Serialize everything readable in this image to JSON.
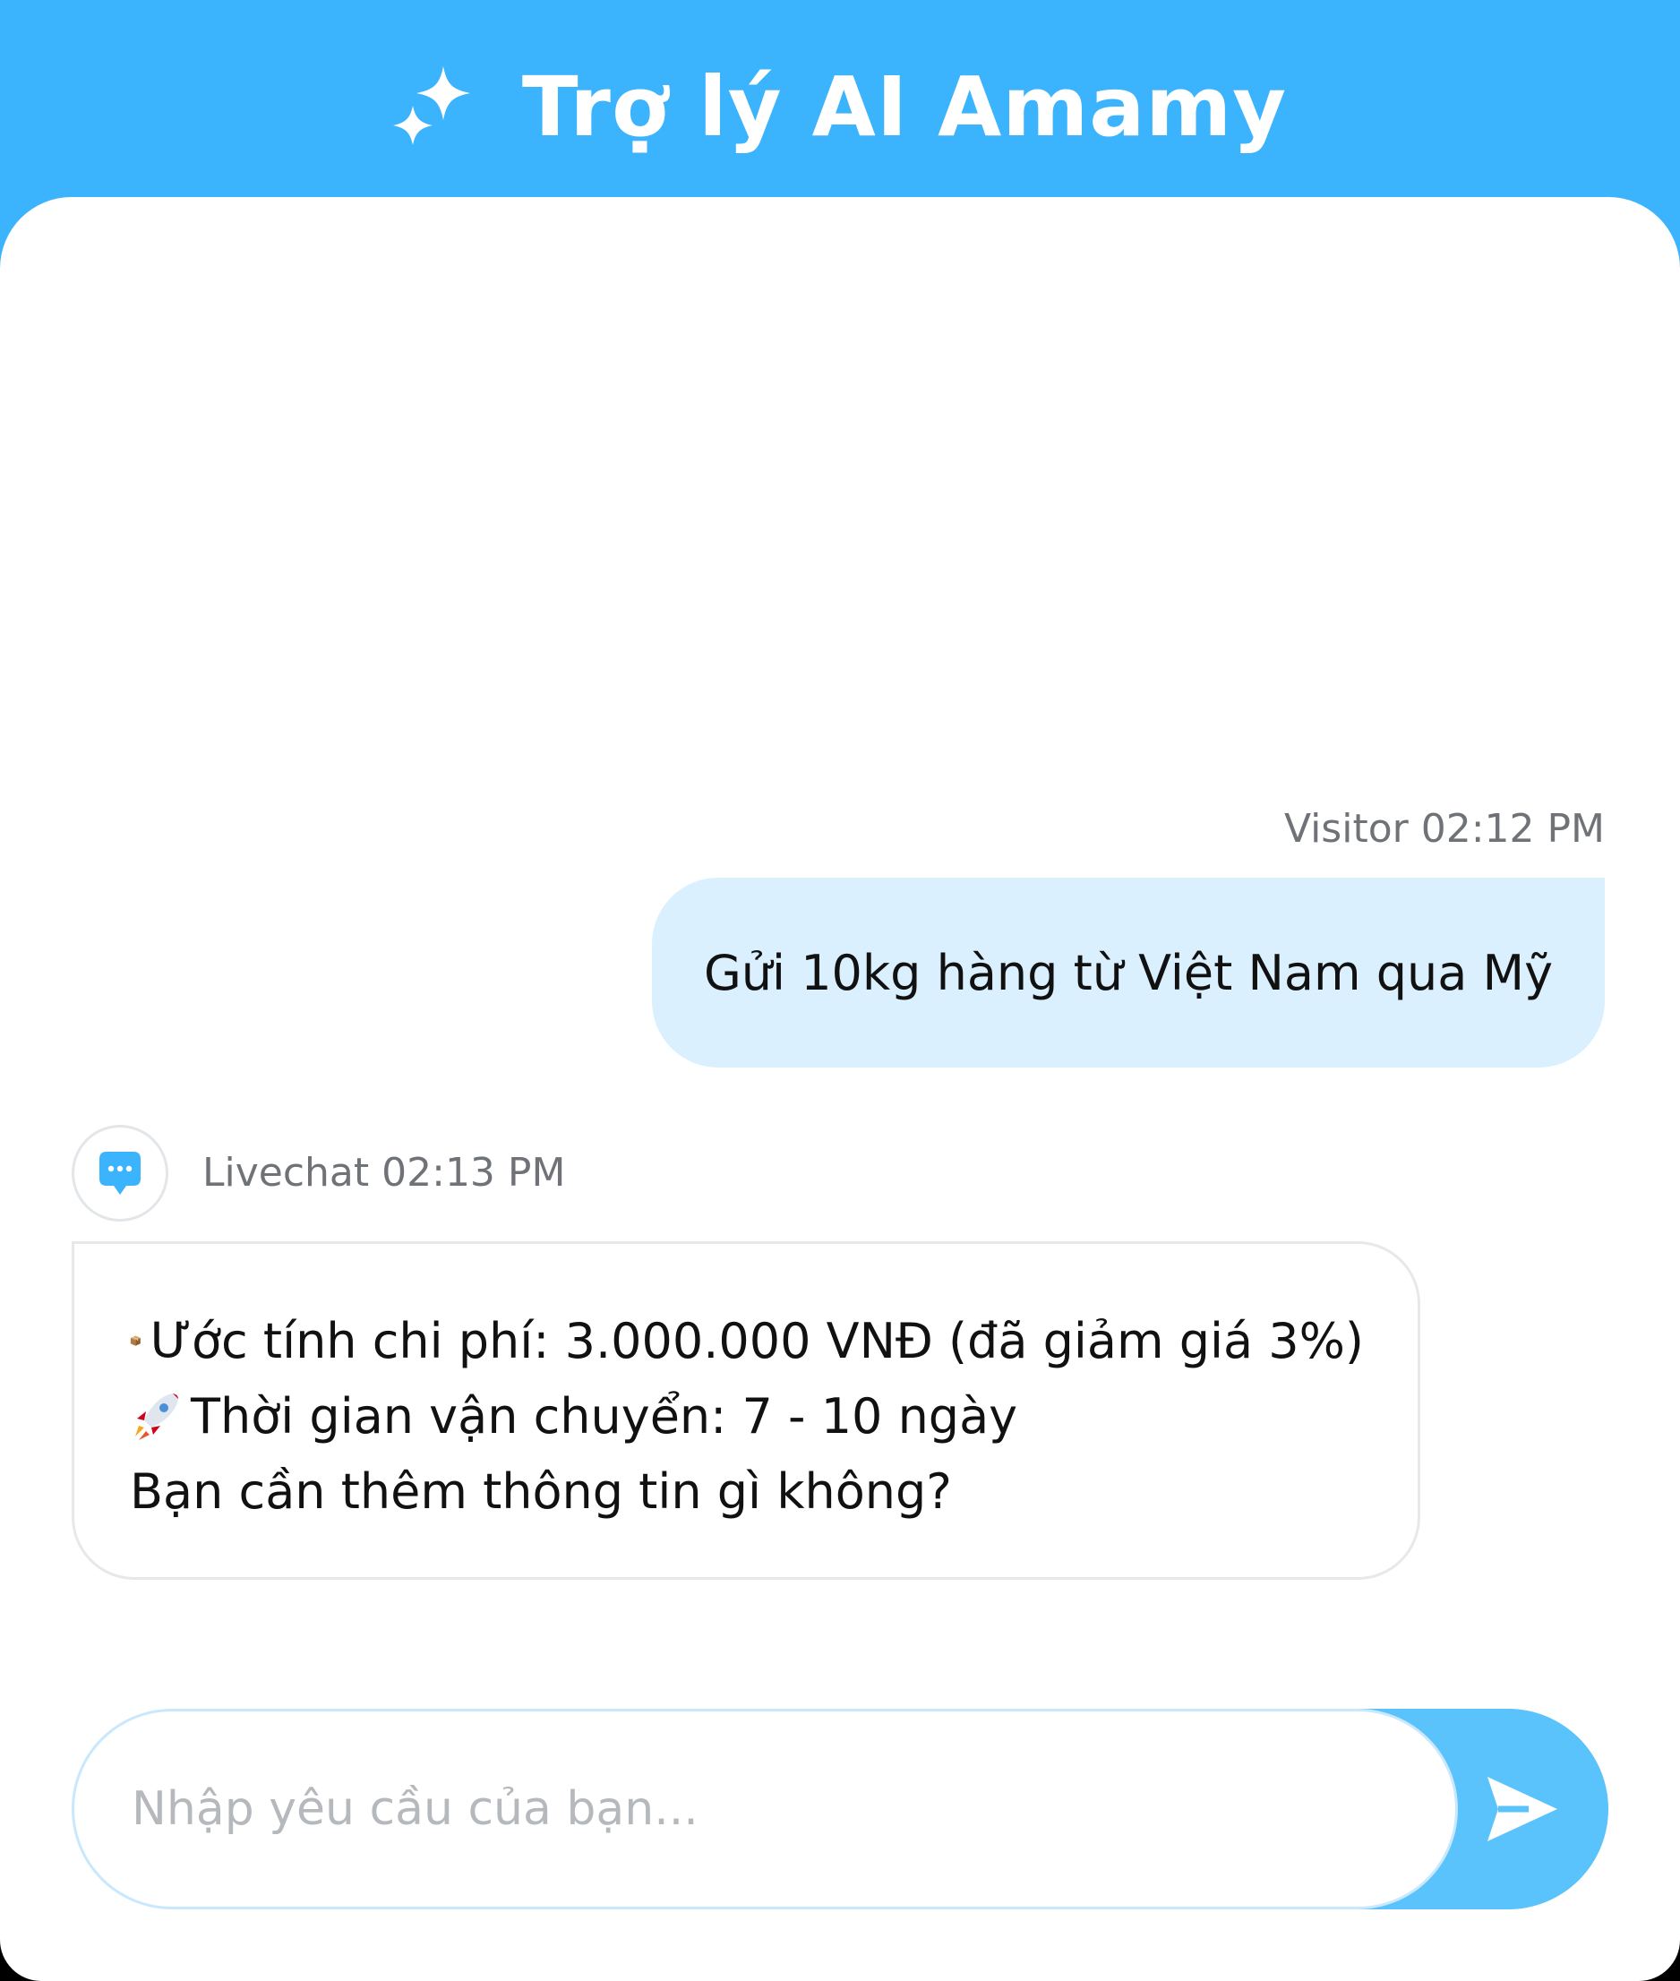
{
  "header": {
    "title": "Trợ lý AI Amamy",
    "icon": "sparkle-icon",
    "background_color": "#3bb3fd"
  },
  "messages": [
    {
      "sender": "Visitor",
      "time": "02:12 PM",
      "meta": "Visitor 02:12 PM",
      "text": "Gửi 10kg hàng từ Việt Nam qua Mỹ"
    },
    {
      "sender": "Livechat",
      "time": "02:13 PM",
      "meta": "Livechat 02:13 PM",
      "avatar_icon": "chat-bubble-icon",
      "lines": [
        {
          "icon": "package-icon",
          "text": "Ước tính chi phí: 3.000.000 VNĐ (đã giảm giá 3%)"
        },
        {
          "icon": "rocket-icon",
          "text": "Thời gian vận chuyển: 7 - 10 ngày"
        },
        {
          "icon": null,
          "text": "Bạn cần thêm thông tin gì không?"
        }
      ]
    }
  ],
  "composer": {
    "placeholder": "Nhập yêu cầu của bạn...",
    "value": "",
    "send_icon": "send-icon",
    "accent_color": "#5ac3fb"
  }
}
